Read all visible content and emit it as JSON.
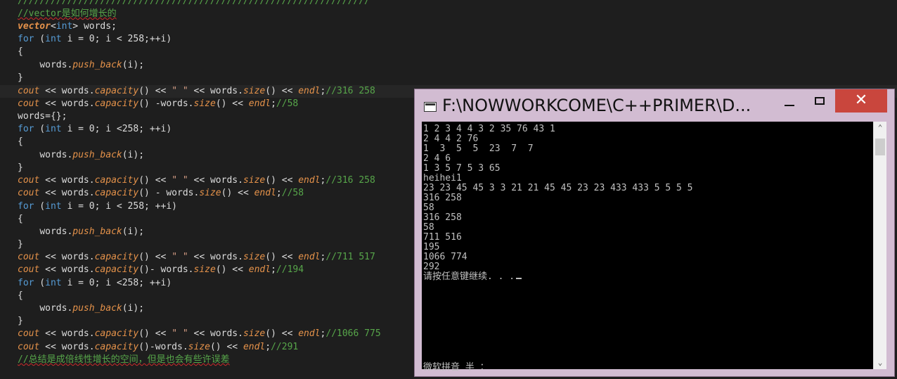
{
  "editor": {
    "lines": [
      "////////////////////////////////////////////////////////////////",
      "//vector是如何增长的",
      "vector<int> words;",
      "for (int i = 0; i < 258;++i)",
      "{",
      "    words.push_back(i);",
      "}",
      "cout << words.capacity() << \" \" << words.size() << endl;//316 258",
      "cout << words.capacity() -words.size() << endl;//58",
      "words={};",
      "for (int i = 0; i <258; ++i)",
      "{",
      "    words.push_back(i);",
      "}",
      "cout << words.capacity() << \" \" << words.size() << endl;//316 258",
      "cout << words.capacity() - words.size() << endl;//58",
      "for (int i = 0; i < 258; ++i)",
      "{",
      "    words.push_back(i);",
      "}",
      "cout << words.capacity() << \" \" << words.size() << endl;//711 517",
      "cout << words.capacity()- words.size() << endl;//194",
      "for (int i = 0; i <258; ++i)",
      "{",
      "    words.push_back(i);",
      "}",
      "cout << words.capacity() << \" \" << words.size() << endl;//1066 775",
      "cout << words.capacity()-words.size() << endl;//291",
      "//总结是成倍线性增长的空间，但是也会有些许误差"
    ]
  },
  "console": {
    "title": "F:\\NOWWORKCOME\\C++PRIMER\\D...",
    "close_glyph": "✕",
    "output_lines": [
      "1 2 3 4 4 3 2 35 76 43 1",
      "2 4 4 2 76",
      "1  3  5  5  23  7  7",
      "2 4 6",
      "1 3 5 7 5 3 65",
      "heihei1",
      "23 23 45 45 3 3 21 21 45 45 23 23 433 433 5 5 5 5",
      "316 258",
      "58",
      "316 258",
      "58",
      "711 516",
      "195",
      "1066 774",
      "292",
      "请按任意键继续. . ."
    ],
    "ime_status": "微软拼音 半 ："
  }
}
